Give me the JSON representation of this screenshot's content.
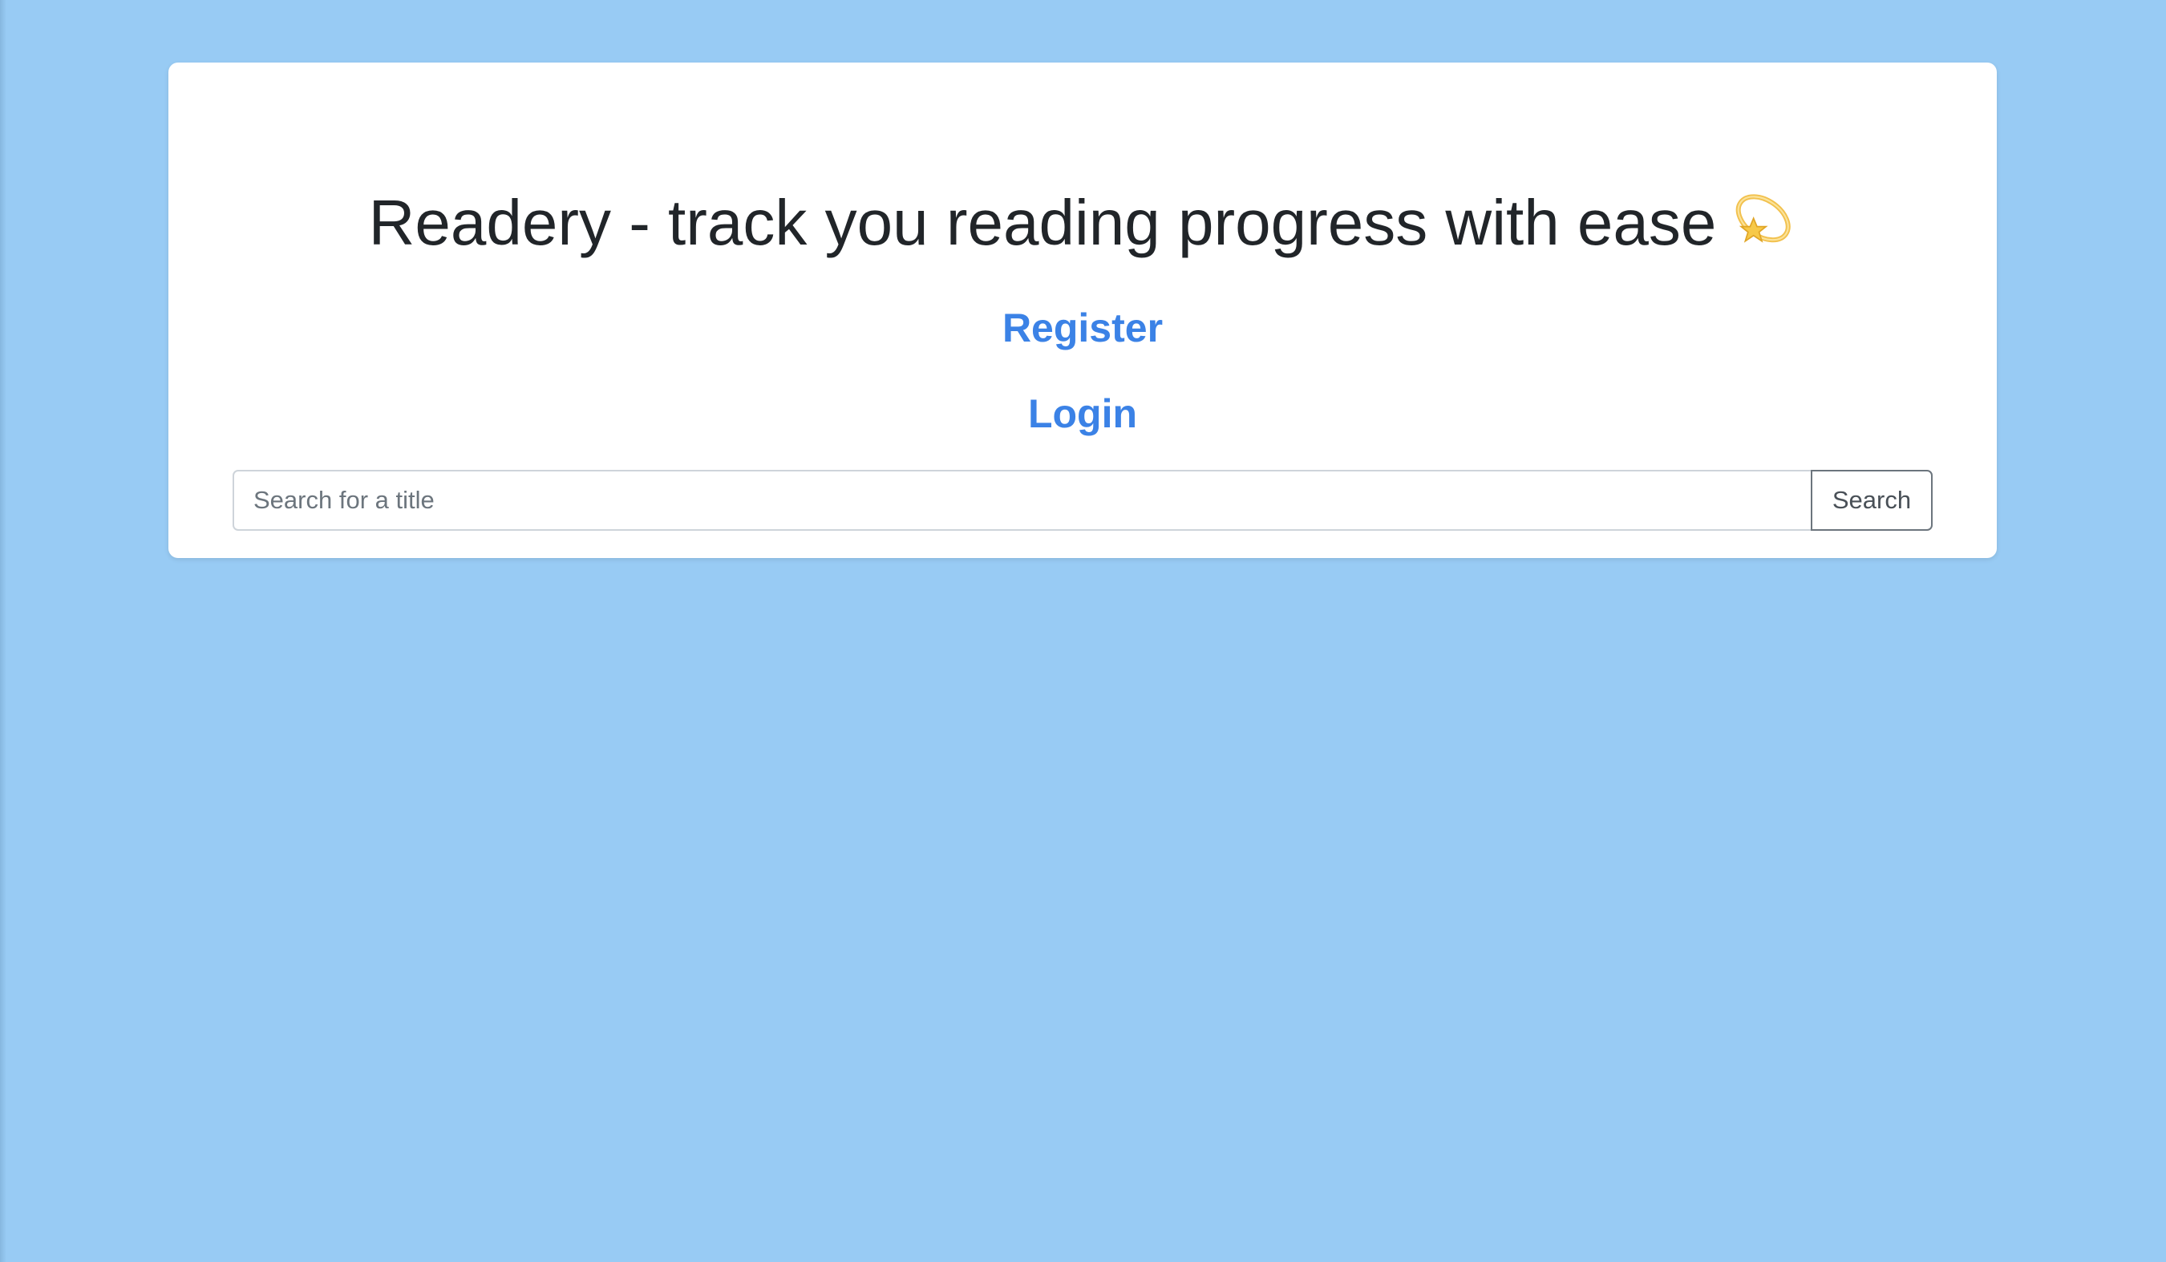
{
  "header": {
    "title": "Readery - track you reading progress with ease",
    "title_emoji_icon": "dizzy-star-icon"
  },
  "nav": {
    "register_label": "Register",
    "login_label": "Login"
  },
  "search": {
    "placeholder": "Search for a title",
    "value": "",
    "button_label": "Search"
  },
  "colors": {
    "background": "#98cbf4",
    "card": "#ffffff",
    "link": "#3b82e6",
    "title_text": "#212529"
  }
}
